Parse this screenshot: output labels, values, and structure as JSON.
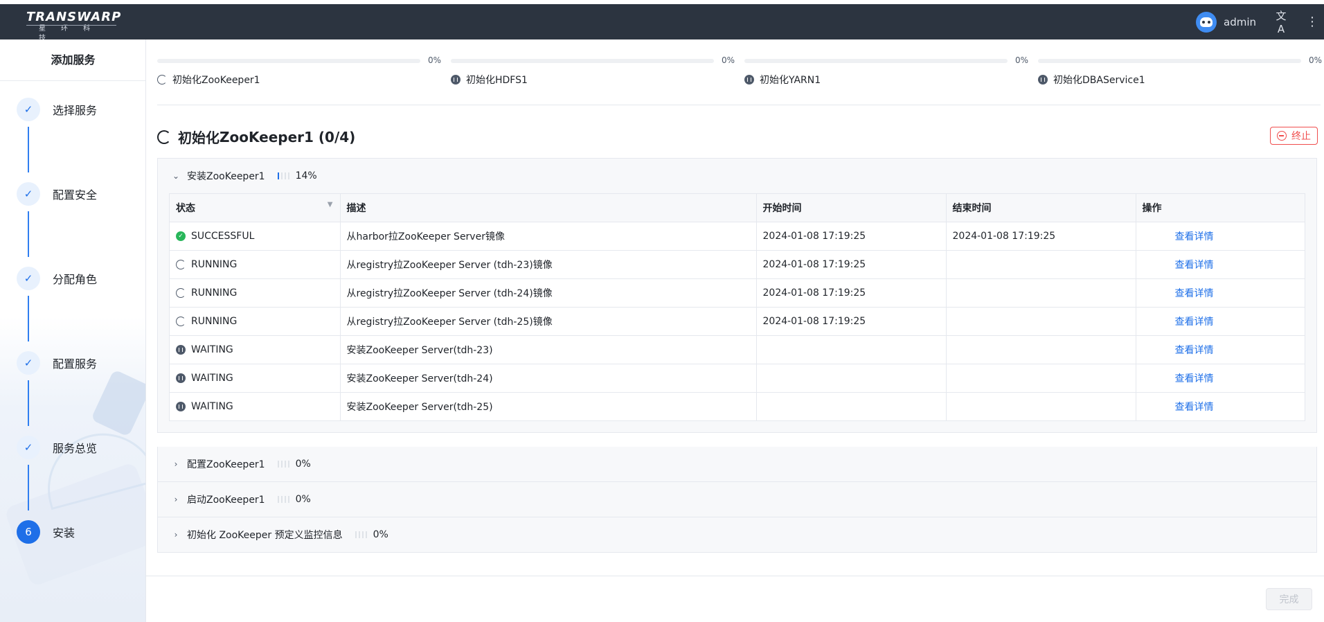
{
  "header": {
    "logo_main": "TRANSWARP",
    "logo_sub": "星环科技",
    "user": "admin",
    "translate_glyph": "文A",
    "more_glyph": "⋮"
  },
  "sidebar": {
    "title": "添加服务",
    "steps": [
      {
        "label": "选择服务",
        "marker": "✓"
      },
      {
        "label": "配置安全",
        "marker": "✓"
      },
      {
        "label": "分配角色",
        "marker": "✓"
      },
      {
        "label": "配置服务",
        "marker": "✓"
      },
      {
        "label": "服务总览",
        "marker": "✓"
      },
      {
        "label": "安装",
        "marker": "6"
      }
    ]
  },
  "overview": [
    {
      "label": "初始化ZooKeeper1",
      "percent": "0%",
      "status": "running"
    },
    {
      "label": "初始化HDFS1",
      "percent": "0%",
      "status": "waiting"
    },
    {
      "label": "初始化YARN1",
      "percent": "0%",
      "status": "waiting"
    },
    {
      "label": "初始化DBAService1",
      "percent": "0%",
      "status": "waiting"
    }
  ],
  "section": {
    "title_bold": "初始化",
    "title_rest": "ZooKeeper1 (0/4)",
    "stop_label": "终止"
  },
  "panels": [
    {
      "label": "安装ZooKeeper1",
      "percent": "14%",
      "progress": 0.14,
      "expanded": true
    },
    {
      "label": "配置ZooKeeper1",
      "percent": "0%",
      "progress": 0,
      "expanded": false
    },
    {
      "label": "启动ZooKeeper1",
      "percent": "0%",
      "progress": 0,
      "expanded": false
    },
    {
      "label": "初始化 ZooKeeper 预定义监控信息",
      "percent": "0%",
      "progress": 0,
      "expanded": false
    }
  ],
  "table": {
    "columns": [
      "状态",
      "描述",
      "开始时间",
      "结束时间",
      "操作"
    ],
    "rows": [
      {
        "status": "SUCCESSFUL",
        "desc": "从harbor拉ZooKeeper Server镜像",
        "start": "2024-01-08 17:19:25",
        "end": "2024-01-08 17:19:25",
        "action": "查看详情"
      },
      {
        "status": "RUNNING",
        "desc": "从registry拉ZooKeeper Server (tdh-23)镜像",
        "start": "2024-01-08 17:19:25",
        "end": "",
        "action": "查看详情"
      },
      {
        "status": "RUNNING",
        "desc": "从registry拉ZooKeeper Server (tdh-24)镜像",
        "start": "2024-01-08 17:19:25",
        "end": "",
        "action": "查看详情"
      },
      {
        "status": "RUNNING",
        "desc": "从registry拉ZooKeeper Server (tdh-25)镜像",
        "start": "2024-01-08 17:19:25",
        "end": "",
        "action": "查看详情"
      },
      {
        "status": "WAITING",
        "desc": "安装ZooKeeper Server(tdh-23)",
        "start": "",
        "end": "",
        "action": "查看详情"
      },
      {
        "status": "WAITING",
        "desc": "安装ZooKeeper Server(tdh-24)",
        "start": "",
        "end": "",
        "action": "查看详情"
      },
      {
        "status": "WAITING",
        "desc": "安装ZooKeeper Server(tdh-25)",
        "start": "",
        "end": "",
        "action": "查看详情"
      }
    ]
  },
  "footer": {
    "done_label": "完成"
  },
  "colors": {
    "accent": "#1e6fe8",
    "danger": "#f04d4d",
    "success": "#28b65a",
    "header_bg": "#2c3440"
  }
}
